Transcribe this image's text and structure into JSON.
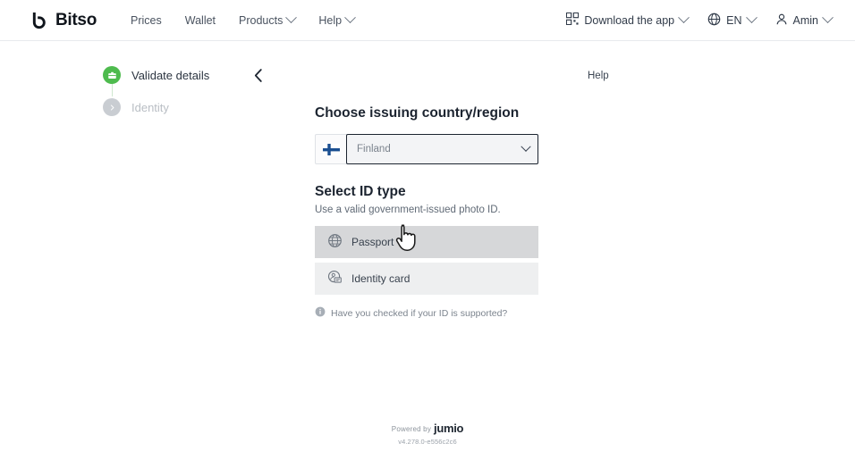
{
  "header": {
    "brand_name": "Bitso",
    "brand_icon": "bitso-logo-icon",
    "nav": [
      {
        "label": "Prices",
        "has_caret": false
      },
      {
        "label": "Wallet",
        "has_caret": false
      },
      {
        "label": "Products",
        "has_caret": true
      },
      {
        "label": "Help",
        "has_caret": true
      }
    ],
    "right": {
      "download_app": {
        "label": "Download the app",
        "icon": "qr-code-icon"
      },
      "language": {
        "label": "EN",
        "icon": "globe-icon"
      },
      "account": {
        "label": "Amin",
        "icon": "user-icon"
      }
    }
  },
  "stepper": {
    "steps": [
      {
        "label": "Validate details",
        "state": "active",
        "icon": "id-badge-icon"
      },
      {
        "label": "Identity",
        "state": "inactive",
        "icon": "chevron-right-icon"
      }
    ]
  },
  "back_button": {
    "icon": "chevron-left-icon"
  },
  "help_link": {
    "label": "Help"
  },
  "main": {
    "country_section": {
      "title": "Choose issuing country/region",
      "selected_country": "Finland",
      "flag_icon": "finland-flag-icon",
      "chevron_icon": "chevron-down-icon"
    },
    "id_type_section": {
      "title": "Select ID type",
      "subtitle": "Use a valid government-issued photo ID.",
      "options": [
        {
          "label": "Passport",
          "icon": "globe-icon",
          "state": "hovered"
        },
        {
          "label": "Identity card",
          "icon": "id-card-icon",
          "state": "normal"
        }
      ],
      "note": {
        "icon": "info-icon",
        "text": "Have you checked if your ID is supported?"
      }
    }
  },
  "footer": {
    "powered_by": "Powered by",
    "vendor": "jumio",
    "version": "v4.278.0-e556c2c6"
  },
  "colors": {
    "accent_green": "#4ebb4e",
    "flag_blue": "#1b4f91",
    "text_dark": "#1c2430",
    "option_hover_bg": "#d6d7d9",
    "option_bg": "#eeeff0"
  }
}
